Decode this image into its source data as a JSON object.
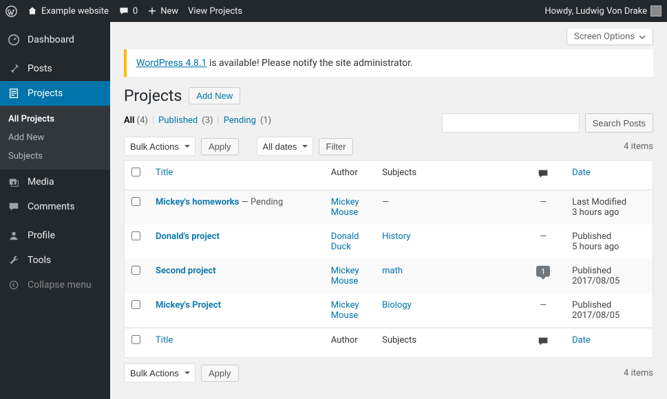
{
  "toolbar": {
    "site_name": "Example website",
    "comment_count": "0",
    "new_label": "New",
    "view_projects": "View Projects",
    "howdy": "Howdy, Ludwig Von Drake"
  },
  "sidebar": {
    "dashboard": "Dashboard",
    "posts": "Posts",
    "projects": "Projects",
    "projects_sub": {
      "all": "All Projects",
      "add_new": "Add New",
      "subjects": "Subjects"
    },
    "media": "Media",
    "comments": "Comments",
    "profile": "Profile",
    "tools": "Tools",
    "collapse": "Collapse menu"
  },
  "screen_options": "Screen Options",
  "notice": {
    "link": "WordPress 4.8.1",
    "rest": " is available! Please notify the site administrator."
  },
  "page": {
    "title": "Projects",
    "add_new": "Add New"
  },
  "views": {
    "all_label": "All",
    "all_count": "(4)",
    "published_label": "Published",
    "published_count": "(3)",
    "pending_label": "Pending",
    "pending_count": "(1)"
  },
  "search": {
    "button": "Search Posts",
    "value": ""
  },
  "bulk": {
    "label": "Bulk Actions",
    "apply": "Apply"
  },
  "dates": {
    "label": "All dates",
    "filter": "Filter"
  },
  "items_count": "4 items",
  "columns": {
    "title": "Title",
    "author": "Author",
    "subjects": "Subjects",
    "date": "Date"
  },
  "rows": [
    {
      "title": "Mickey's homeworks",
      "state": " — Pending",
      "author": "Mickey Mouse",
      "subjects": "—",
      "comments": "—",
      "date_line1": "Last Modified",
      "date_line2": "3 hours ago"
    },
    {
      "title": "Donald's project",
      "state": "",
      "author": "Donald Duck",
      "subjects": "History",
      "comments": "—",
      "date_line1": "Published",
      "date_line2": "5 hours ago"
    },
    {
      "title": "Second project",
      "state": "",
      "author": "Mickey Mouse",
      "subjects": "math",
      "comments": "1",
      "date_line1": "Published",
      "date_line2": "2017/08/05"
    },
    {
      "title": "Mickey's Project",
      "state": "",
      "author": "Mickey Mouse",
      "subjects": "Biology",
      "comments": "—",
      "date_line1": "Published",
      "date_line2": "2017/08/05"
    }
  ]
}
